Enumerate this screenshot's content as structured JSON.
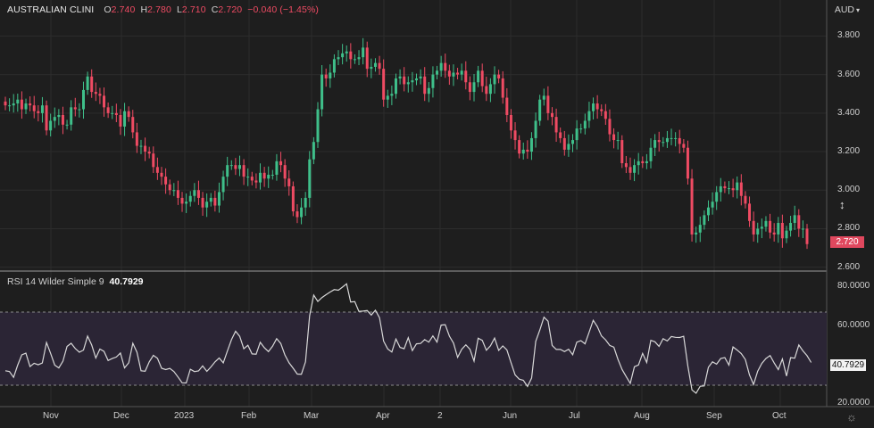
{
  "header": {
    "symbol": "AUSTRALIAN CLINI",
    "o_label": "O",
    "o_value": "2.740",
    "h_label": "H",
    "h_value": "2.780",
    "l_label": "L",
    "l_value": "2.710",
    "c_label": "C",
    "c_value": "2.720",
    "change": "−0.040 (−1.45%)"
  },
  "currency": "AUD",
  "last_price": "2.720",
  "rsi": {
    "label": "RSI 14 Wilder Simple 9",
    "value": "40.7929"
  },
  "price_axis": [
    "3.800",
    "3.600",
    "3.400",
    "3.200",
    "3.000",
    "2.800",
    "2.600"
  ],
  "rsi_axis": [
    "80.0000",
    "60.0000",
    "20.0000"
  ],
  "x_axis": [
    "Nov",
    "Dec",
    "2023",
    "Feb",
    "Mar",
    "Apr",
    "2",
    "Jun",
    "Jul",
    "Aug",
    "Sep",
    "Oct"
  ],
  "colors": {
    "up": "#3fbf8a",
    "down": "#ef4b63",
    "rsi_line": "#d8d8d8",
    "rsi_band": "#2b2535",
    "border": "#2f6fd6"
  },
  "chart_data": {
    "type": "candlestick",
    "price_ylim": [
      2.58,
      3.95
    ],
    "closes": [
      3.44,
      3.44,
      3.45,
      3.47,
      3.42,
      3.45,
      3.44,
      3.41,
      3.4,
      3.44,
      3.31,
      3.36,
      3.38,
      3.39,
      3.34,
      3.34,
      3.43,
      3.42,
      3.42,
      3.52,
      3.59,
      3.51,
      3.5,
      3.49,
      3.43,
      3.4,
      3.4,
      3.39,
      3.33,
      3.41,
      3.38,
      3.3,
      3.23,
      3.23,
      3.2,
      3.19,
      3.12,
      3.09,
      3.07,
      3.03,
      3.0,
      3.0,
      2.96,
      2.93,
      2.94,
      2.97,
      3.0,
      2.96,
      2.91,
      2.94,
      2.96,
      2.92,
      2.99,
      3.07,
      3.13,
      3.13,
      3.11,
      3.13,
      3.07,
      3.07,
      3.05,
      3.04,
      3.09,
      3.06,
      3.08,
      3.08,
      3.15,
      3.13,
      3.06,
      3.02,
      2.89,
      2.86,
      2.91,
      2.96,
      3.16,
      3.25,
      3.42,
      3.6,
      3.58,
      3.61,
      3.68,
      3.69,
      3.71,
      3.72,
      3.68,
      3.68,
      3.69,
      3.74,
      3.63,
      3.64,
      3.66,
      3.63,
      3.47,
      3.49,
      3.5,
      3.58,
      3.59,
      3.55,
      3.56,
      3.57,
      3.58,
      3.59,
      3.5,
      3.53,
      3.6,
      3.62,
      3.66,
      3.62,
      3.59,
      3.61,
      3.6,
      3.62,
      3.56,
      3.51,
      3.56,
      3.62,
      3.54,
      3.5,
      3.55,
      3.6,
      3.58,
      3.48,
      3.39,
      3.31,
      3.26,
      3.19,
      3.21,
      3.2,
      3.27,
      3.36,
      3.47,
      3.49,
      3.4,
      3.38,
      3.3,
      3.27,
      3.21,
      3.24,
      3.26,
      3.32,
      3.32,
      3.36,
      3.41,
      3.45,
      3.42,
      3.41,
      3.37,
      3.29,
      3.26,
      3.26,
      3.14,
      3.12,
      3.09,
      3.13,
      3.15,
      3.14,
      3.15,
      3.22,
      3.26,
      3.25,
      3.25,
      3.27,
      3.27,
      3.27,
      3.24,
      3.22,
      3.06,
      2.77,
      2.78,
      2.82,
      2.87,
      2.91,
      2.94,
      2.99,
      3.02,
      3.01,
      3.01,
      3.0,
      3.04,
      2.97,
      2.93,
      2.84,
      2.77,
      2.8,
      2.81,
      2.84,
      2.78,
      2.77,
      2.83,
      2.75,
      2.79,
      2.83,
      2.87,
      2.8,
      2.8,
      2.72
    ],
    "rsi_values": [
      36.5,
      36.1,
      33.1,
      39.4,
      44.7,
      45.6,
      38.7,
      40.4,
      39.6,
      40.5,
      51.1,
      45.5,
      39.4,
      38.0,
      41.5,
      49.1,
      50.7,
      48.0,
      46.1,
      47.2,
      54.4,
      49.8,
      43.1,
      47.7,
      46.5,
      41.8,
      42.8,
      43.6,
      45.7,
      38.0,
      40.6,
      50.7,
      46.1,
      36.5,
      36.3,
      41.1,
      44.5,
      42.9,
      37.8,
      37.1,
      37.7,
      36.1,
      33.3,
      30.3,
      30.2,
      37.3,
      36.1,
      36.4,
      39.0,
      36.2,
      38.5,
      41.1,
      43.1,
      40.6,
      46.7,
      52.6,
      56.9,
      54.3,
      47.9,
      49.7,
      45.2,
      45.1,
      51.2,
      48.4,
      46.4,
      49.2,
      53.1,
      50.6,
      44.7,
      40.6,
      37.8,
      34.8,
      34.7,
      41.1,
      64.9,
      75.6,
      72.3,
      74.3,
      75.8,
      77.2,
      78.4,
      78.1,
      79.7,
      81.4,
      72.0,
      72.2,
      67.2,
      67.3,
      67.6,
      65.3,
      67.8,
      63.9,
      51.8,
      47.8,
      46.2,
      52.9,
      48.6,
      47.9,
      53.6,
      46.9,
      50.4,
      50.6,
      52.6,
      51.3,
      54.5,
      51.3,
      60.1,
      60.3,
      54.4,
      50.8,
      43.4,
      47.6,
      49.9,
      47.6,
      41.5,
      53.3,
      52.2,
      47.1,
      49.4,
      53.4,
      47.0,
      49.3,
      47.3,
      40.7,
      34.4,
      32.2,
      31.6,
      28.4,
      32.8,
      51.7,
      57.6,
      64.2,
      62.1,
      49.6,
      47.5,
      47.5,
      46.4,
      47.6,
      44.8,
      51.3,
      52.1,
      50.4,
      56.4,
      62.6,
      59.3,
      54.5,
      52.5,
      49.6,
      48.7,
      42.4,
      37.2,
      33.5,
      30.0,
      38.6,
      39.5,
      45.5,
      40.8,
      52.2,
      51.5,
      49.1,
      53.1,
      51.9,
      54.2,
      53.8,
      53.7,
      54.3,
      38.9,
      26.6,
      24.9,
      28.5,
      28.7,
      38.3,
      41.1,
      39.9,
      42.8,
      43.3,
      39.4,
      48.8,
      47.2,
      45.4,
      42.3,
      34.4,
      29.4,
      36.3,
      40.3,
      42.8,
      44.4,
      40.5,
      37.1,
      42.6,
      33.8,
      43.3,
      43.0,
      49.8,
      46.8,
      44.3,
      40.8
    ],
    "rsi_ylim": [
      18,
      88
    ],
    "rsi_levels": [
      70,
      30
    ],
    "x_labels": [
      "Nov",
      "Dec",
      "2023",
      "Feb",
      "Mar",
      "Apr",
      "2",
      "Jun",
      "Jul",
      "Aug",
      "Sep",
      "Oct"
    ]
  }
}
